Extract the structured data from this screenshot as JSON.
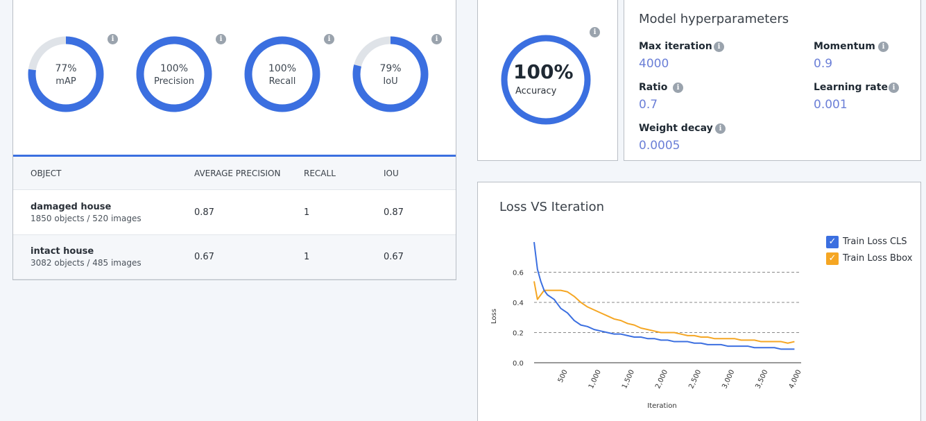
{
  "metrics": [
    {
      "value": "77%",
      "label": "mAP",
      "fraction": 0.77
    },
    {
      "value": "100%",
      "label": "Precision",
      "fraction": 1.0
    },
    {
      "value": "100%",
      "label": "Recall",
      "fraction": 1.0
    },
    {
      "value": "79%",
      "label": "IoU",
      "fraction": 0.79
    }
  ],
  "info_glyph": "i",
  "table": {
    "headers": [
      "OBJECT",
      "AVERAGE PRECISION",
      "RECALL",
      "IOU"
    ],
    "rows": [
      {
        "name": "damaged house",
        "sub": "1850 objects / 520 images",
        "ap": "0.87",
        "recall": "1",
        "iou": "0.87"
      },
      {
        "name": "intact house",
        "sub": "3082 objects / 485 images",
        "ap": "0.67",
        "recall": "1",
        "iou": "0.67"
      }
    ]
  },
  "accuracy": {
    "value": "100%",
    "label": "Accuracy",
    "fraction": 1.0
  },
  "hyperparameters": {
    "title": "Model hyperparameters",
    "items": [
      {
        "label": "Max iteration",
        "value": "4000"
      },
      {
        "label": "Momentum",
        "value": "0.9"
      },
      {
        "label": "Ratio",
        "value": "0.7"
      },
      {
        "label": "Learning rate",
        "value": "0.001"
      },
      {
        "label": "Weight decay",
        "value": "0.0005"
      }
    ]
  },
  "colors": {
    "accent": "#3b6fe0",
    "ring_track": "#dfe3e8",
    "series_cls": "#3b6fe0",
    "series_bbox": "#f5a623",
    "hp_value": "#6b7fd7"
  },
  "chart_data": {
    "type": "line",
    "title": "Loss VS Iteration",
    "xlabel": "Iteration",
    "ylabel": "Loss",
    "xlim": [
      0,
      4000
    ],
    "ylim": [
      0,
      0.8
    ],
    "x_ticks": [
      "500",
      "1,000",
      "1,500",
      "2,000",
      "2,500",
      "3,000",
      "3,500",
      "4,000"
    ],
    "y_ticks": [
      "0.0",
      "0.2",
      "0.4",
      "0.6"
    ],
    "grid": "dashed horizontal",
    "legend": "top-right",
    "x": [
      0,
      50,
      100,
      150,
      200,
      300,
      400,
      500,
      600,
      700,
      800,
      900,
      1000,
      1100,
      1200,
      1300,
      1400,
      1500,
      1600,
      1700,
      1800,
      1900,
      2000,
      2100,
      2200,
      2300,
      2400,
      2500,
      2600,
      2700,
      2800,
      2900,
      3000,
      3100,
      3200,
      3300,
      3400,
      3500,
      3600,
      3700,
      3800,
      3900
    ],
    "series": [
      {
        "name": "Train Loss CLS",
        "values": [
          0.8,
          0.62,
          0.54,
          0.48,
          0.45,
          0.42,
          0.36,
          0.33,
          0.28,
          0.25,
          0.24,
          0.22,
          0.21,
          0.2,
          0.19,
          0.19,
          0.18,
          0.17,
          0.17,
          0.16,
          0.16,
          0.15,
          0.15,
          0.14,
          0.14,
          0.14,
          0.13,
          0.13,
          0.12,
          0.12,
          0.12,
          0.11,
          0.11,
          0.11,
          0.11,
          0.1,
          0.1,
          0.1,
          0.1,
          0.09,
          0.09,
          0.09
        ]
      },
      {
        "name": "Train Loss Bbox",
        "values": [
          0.54,
          0.42,
          0.45,
          0.48,
          0.48,
          0.48,
          0.48,
          0.47,
          0.44,
          0.4,
          0.37,
          0.35,
          0.33,
          0.31,
          0.29,
          0.28,
          0.26,
          0.25,
          0.23,
          0.22,
          0.21,
          0.2,
          0.2,
          0.2,
          0.19,
          0.18,
          0.18,
          0.17,
          0.17,
          0.16,
          0.16,
          0.16,
          0.16,
          0.15,
          0.15,
          0.15,
          0.14,
          0.14,
          0.14,
          0.14,
          0.13,
          0.14
        ]
      }
    ]
  }
}
